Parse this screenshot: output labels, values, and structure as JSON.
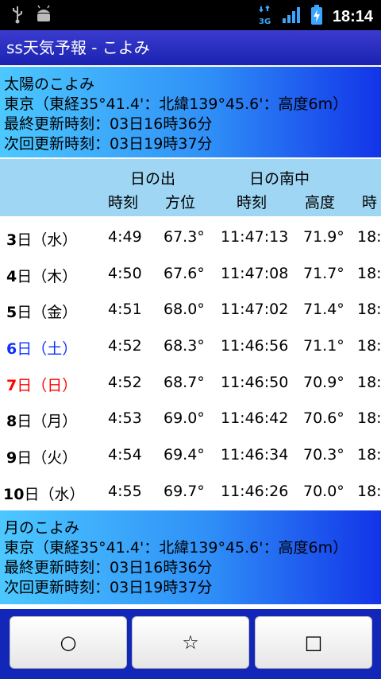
{
  "status_bar": {
    "time": "18:14",
    "network_label": "3G"
  },
  "app_title": "ss天気予報 - こよみ",
  "sun_panel": {
    "title": "太陽のこよみ",
    "location": "東京（東経35°41.4'：北緯139°45.6'：高度6m）",
    "last_update": "最終更新時刻：03日16時36分",
    "next_update": "次回更新時刻：03日19時37分"
  },
  "table_header": {
    "sunrise_group": "日の出",
    "transit_group": "日の南中",
    "sunrise_time": "時刻",
    "sunrise_azimuth": "方位",
    "transit_time": "時刻",
    "transit_altitude": "高度",
    "sunset_time_partial": "時"
  },
  "rows": [
    {
      "date_num": "3",
      "date_suffix": "日（水）",
      "sunrise": "4:49",
      "azimuth": "67.3°",
      "transit": "11:47:13",
      "altitude": "71.9°",
      "sunset_partial": "18:"
    },
    {
      "date_num": "4",
      "date_suffix": "日（木）",
      "sunrise": "4:50",
      "azimuth": "67.6°",
      "transit": "11:47:08",
      "altitude": "71.7°",
      "sunset_partial": "18:"
    },
    {
      "date_num": "5",
      "date_suffix": "日（金）",
      "sunrise": "4:51",
      "azimuth": "68.0°",
      "transit": "11:47:02",
      "altitude": "71.4°",
      "sunset_partial": "18:"
    },
    {
      "date_num": "6",
      "date_suffix": "日（土）",
      "sunrise": "4:52",
      "azimuth": "68.3°",
      "transit": "11:46:56",
      "altitude": "71.1°",
      "sunset_partial": "18:"
    },
    {
      "date_num": "7",
      "date_suffix": "日（日）",
      "sunrise": "4:52",
      "azimuth": "68.7°",
      "transit": "11:46:50",
      "altitude": "70.9°",
      "sunset_partial": "18:"
    },
    {
      "date_num": "8",
      "date_suffix": "日（月）",
      "sunrise": "4:53",
      "azimuth": "69.0°",
      "transit": "11:46:42",
      "altitude": "70.6°",
      "sunset_partial": "18:"
    },
    {
      "date_num": "9",
      "date_suffix": "日（火）",
      "sunrise": "4:54",
      "azimuth": "69.4°",
      "transit": "11:46:34",
      "altitude": "70.3°",
      "sunset_partial": "18:"
    },
    {
      "date_num": "10",
      "date_suffix": "日（水）",
      "sunrise": "4:55",
      "azimuth": "69.7°",
      "transit": "11:46:26",
      "altitude": "70.0°",
      "sunset_partial": "18:"
    }
  ],
  "moon_panel": {
    "title": "月のこよみ",
    "location": "東京（東経35°41.4'：北緯139°45.6'：高度6m）",
    "last_update": "最終更新時刻：03日16時36分",
    "next_update": "次回更新時刻：03日19時37分"
  },
  "toolbar": {
    "circle_label": "○",
    "star_label": "☆",
    "square_label": "□"
  },
  "colors": {
    "saturday": "#1030ff",
    "sunday": "#ff0000",
    "header_bg": "#9fd6f3",
    "toolbar_bg": "#1226b8"
  }
}
